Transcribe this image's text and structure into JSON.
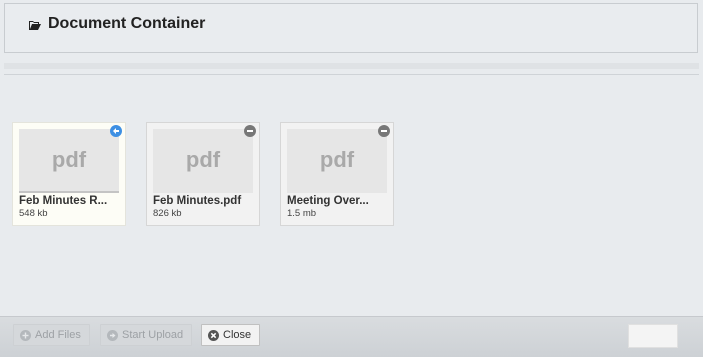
{
  "header": {
    "title": "Document Container",
    "icon": "folder-open-icon"
  },
  "files": [
    {
      "thumb_label": "pdf",
      "name": "Feb Minutes R...",
      "size": "548 kb",
      "badge": "undo-icon",
      "selected": true
    },
    {
      "thumb_label": "pdf",
      "name": "Feb Minutes.pdf",
      "size": "826 kb",
      "badge": "remove-icon",
      "selected": false
    },
    {
      "thumb_label": "pdf",
      "name": "Meeting Over...",
      "size": "1.5 mb",
      "badge": "remove-icon",
      "selected": false
    }
  ],
  "footer": {
    "add_files": "Add Files",
    "start_upload": "Start Upload",
    "close": "Close"
  },
  "colors": {
    "undo_badge": "#3d8fe3",
    "remove_badge": "#777777"
  }
}
